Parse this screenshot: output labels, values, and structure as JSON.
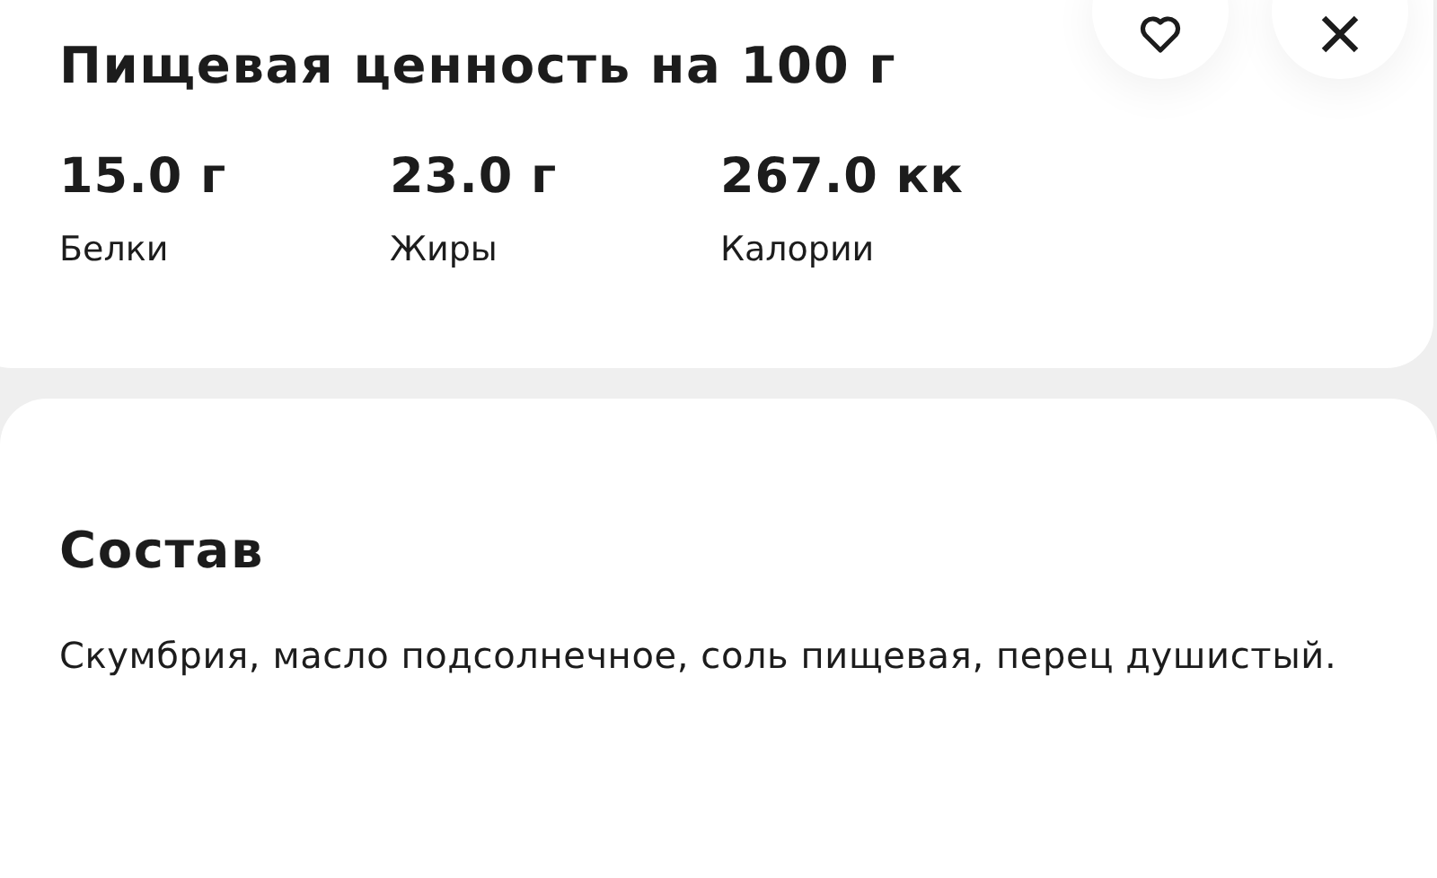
{
  "nutrition": {
    "title": "Пищевая ценность на 100 г",
    "facts": [
      {
        "value": "15.0 г",
        "label": "Белки"
      },
      {
        "value": "23.0 г",
        "label": "Жиры"
      },
      {
        "value": "267.0 кк",
        "label": "Калории"
      }
    ]
  },
  "composition": {
    "title": "Состав",
    "text": "Скумбрия, масло подсолнечное, соль пищевая, перец душистый."
  }
}
